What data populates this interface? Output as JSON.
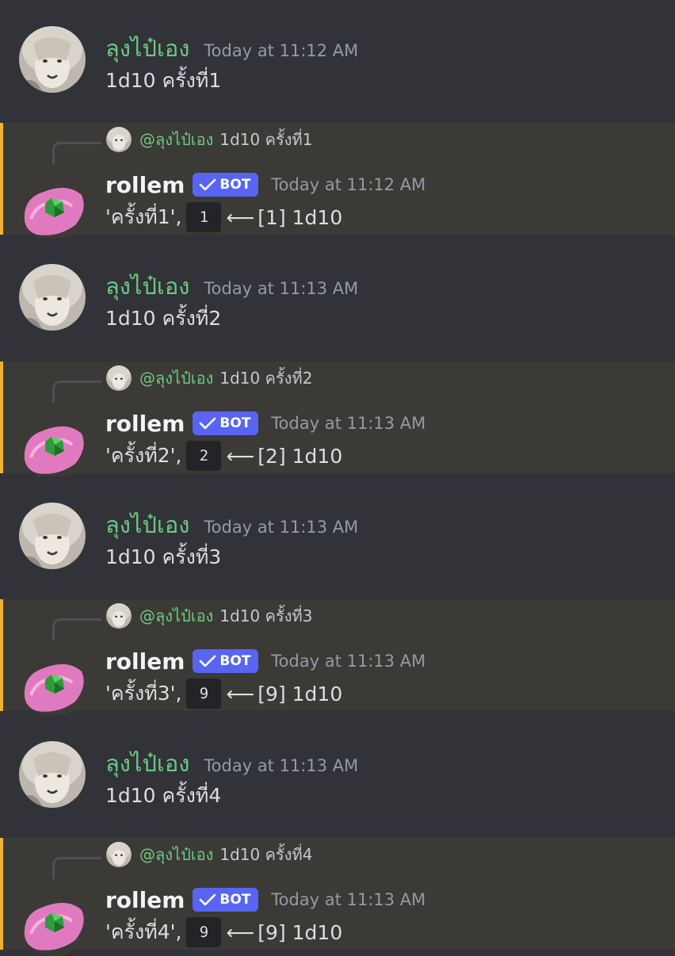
{
  "colors": {
    "background": "#313338",
    "reply_highlight": "#3b3a36",
    "reply_accent": "#f0b232",
    "username_green": "#6ec882",
    "bot_badge": "#5865f2",
    "timestamp": "#949ba4",
    "code_chip": "#232428"
  },
  "user": {
    "name": "ลุงไป๋เอง",
    "avatar_icon": "white-lion-avatar",
    "mention": "@ลุงไป๋เอง"
  },
  "bot": {
    "name": "rollem",
    "badge": "BOT",
    "badge_icon": "checkmark-icon",
    "avatar_icon": "pink-fur-dice-avatar"
  },
  "messages": [
    {
      "user_time": "Today at 11:12 AM",
      "command": "1d10 ครั้งที่1",
      "bot_time": "Today at 11:12 AM",
      "label": "'ครั้งที่1',",
      "result": "1",
      "detail": "[1] 1d10",
      "arrow": "⟵"
    },
    {
      "user_time": "Today at 11:13 AM",
      "command": "1d10 ครั้งที่2",
      "bot_time": "Today at 11:13 AM",
      "label": "'ครั้งที่2',",
      "result": "2",
      "detail": "[2] 1d10",
      "arrow": "⟵"
    },
    {
      "user_time": "Today at 11:13 AM",
      "command": "1d10 ครั้งที่3",
      "bot_time": "Today at 11:13 AM",
      "label": "'ครั้งที่3',",
      "result": "9",
      "detail": "[9] 1d10",
      "arrow": "⟵"
    },
    {
      "user_time": "Today at 11:13 AM",
      "command": "1d10 ครั้งที่4",
      "bot_time": "Today at 11:13 AM",
      "label": "'ครั้งที่4',",
      "result": "9",
      "detail": "[9] 1d10",
      "arrow": "⟵"
    }
  ]
}
